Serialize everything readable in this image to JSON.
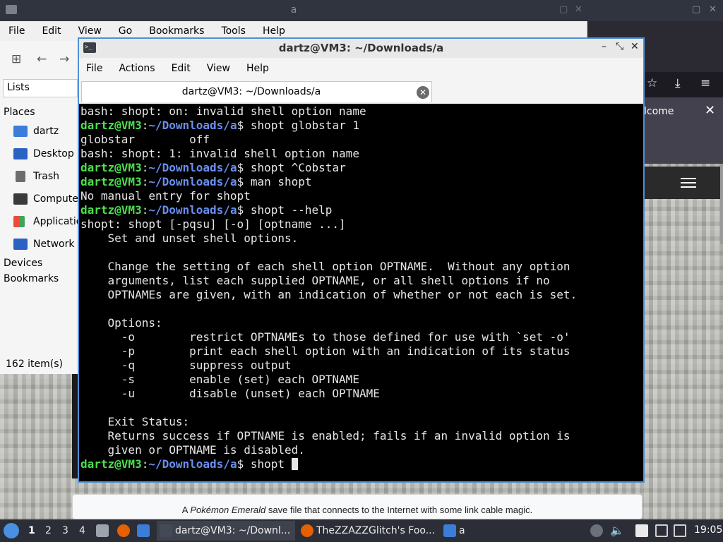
{
  "file_manager": {
    "title": "a",
    "menu": [
      "File",
      "Edit",
      "View",
      "Go",
      "Bookmarks",
      "Tools",
      "Help"
    ],
    "sidebar_mode": "Lists",
    "places_header": "Places",
    "places": [
      "dartz",
      "Desktop",
      "Trash",
      "Computer",
      "Applications",
      "Network"
    ],
    "devices_header": "Devices",
    "bookmarks_header": "Bookmarks",
    "status": "162 item(s)"
  },
  "browser": {
    "notice_text": "lcome"
  },
  "caption": {
    "prefix": "A ",
    "italic": "Pokémon Emerald",
    "suffix": " save file that connects to the Internet with some link cable magic."
  },
  "terminal": {
    "window_title": "dartz@VM3: ~/Downloads/a",
    "menu": [
      "File",
      "Actions",
      "Edit",
      "View",
      "Help"
    ],
    "tab_title": "dartz@VM3: ~/Downloads/a",
    "prompt_user": "dartz@VM3",
    "prompt_sep": ":",
    "prompt_path": "~/Downloads/a",
    "prompt_dollar": "$ ",
    "lines": [
      {
        "type": "out",
        "text": "bash: shopt: on: invalid shell option name"
      },
      {
        "type": "cmd",
        "text": "shopt globstar 1"
      },
      {
        "type": "out",
        "text": "globstar        off"
      },
      {
        "type": "out",
        "text": "bash: shopt: 1: invalid shell option name"
      },
      {
        "type": "cmd",
        "text": "shopt ^Cobstar"
      },
      {
        "type": "cmd",
        "text": "man shopt"
      },
      {
        "type": "out",
        "text": "No manual entry for shopt"
      },
      {
        "type": "cmd",
        "text": "shopt --help"
      },
      {
        "type": "out",
        "text": "shopt: shopt [-pqsu] [-o] [optname ...]"
      },
      {
        "type": "out",
        "text": "    Set and unset shell options."
      },
      {
        "type": "out",
        "text": ""
      },
      {
        "type": "out",
        "text": "    Change the setting of each shell option OPTNAME.  Without any option"
      },
      {
        "type": "out",
        "text": "    arguments, list each supplied OPTNAME, or all shell options if no"
      },
      {
        "type": "out",
        "text": "    OPTNAMEs are given, with an indication of whether or not each is set."
      },
      {
        "type": "out",
        "text": ""
      },
      {
        "type": "out",
        "text": "    Options:"
      },
      {
        "type": "out",
        "text": "      -o        restrict OPTNAMEs to those defined for use with `set -o'"
      },
      {
        "type": "out",
        "text": "      -p        print each shell option with an indication of its status"
      },
      {
        "type": "out",
        "text": "      -q        suppress output"
      },
      {
        "type": "out",
        "text": "      -s        enable (set) each OPTNAME"
      },
      {
        "type": "out",
        "text": "      -u        disable (unset) each OPTNAME"
      },
      {
        "type": "out",
        "text": ""
      },
      {
        "type": "out",
        "text": "    Exit Status:"
      },
      {
        "type": "out",
        "text": "    Returns success if OPTNAME is enabled; fails if an invalid option is"
      },
      {
        "type": "out",
        "text": "    given or OPTNAME is disabled."
      },
      {
        "type": "cmd",
        "text": "shopt ",
        "cursor": true
      }
    ]
  },
  "taskbar": {
    "workspaces": [
      "1",
      "2",
      "3",
      "4"
    ],
    "active_workspace": "1",
    "tasks": [
      {
        "label": "dartz@VM3: ~/Downl...",
        "icon": "terminal-icon"
      },
      {
        "label": "TheZZAZZGlitch's Foo...",
        "icon": "firefox-icon"
      },
      {
        "label": "a",
        "icon": "folder-icon"
      }
    ],
    "clock": "19:05"
  },
  "colors": {
    "prompt_user": "#4ce04c",
    "prompt_path": "#6a8ff0",
    "terminal_bg": "#000000",
    "terminal_border": "#4f8fd6",
    "taskbar_bg": "#2b2e37"
  }
}
